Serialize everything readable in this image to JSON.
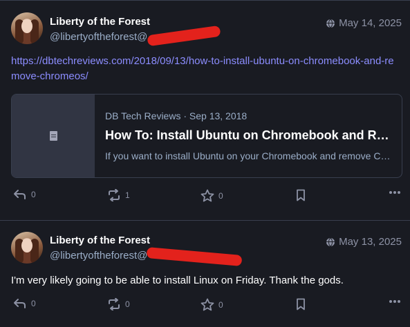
{
  "posts": [
    {
      "display_name": "Liberty of the Forest",
      "handle": "@libertyoftheforest@",
      "date": "May 14, 2025",
      "link": "https://dbtechreviews.com/2018/09/13/how-to-install-ubuntu-on-chromebook-and-remove-chromeos/",
      "card": {
        "meta": "DB Tech Reviews · Sep 13, 2018",
        "title": "How To: Install Ubuntu on Chromebook and Remove ChromeOS",
        "description": "If you want to install Ubuntu on your Chromebook and remove ChromeOS"
      },
      "actions": {
        "replies": "0",
        "boosts": "1",
        "favourites": "0"
      }
    },
    {
      "display_name": "Liberty of the Forest",
      "handle": "@libertyoftheforest@",
      "date": "May 13, 2025",
      "text": "I'm very likely going to be able to install Linux on Friday. Thank the gods.",
      "actions": {
        "replies": "0",
        "boosts": "0",
        "favourites": "0"
      }
    }
  ],
  "icons": {
    "visibility": "globe-icon",
    "reply": "reply-icon",
    "boost": "boost-icon",
    "favourite": "star-icon",
    "bookmark": "bookmark-icon",
    "more": "more-icon",
    "link_card": "document-icon"
  },
  "colors": {
    "background": "#191b22",
    "link": "#8c8dff",
    "muted": "#8d92a5",
    "redaction": "#e3221c"
  }
}
